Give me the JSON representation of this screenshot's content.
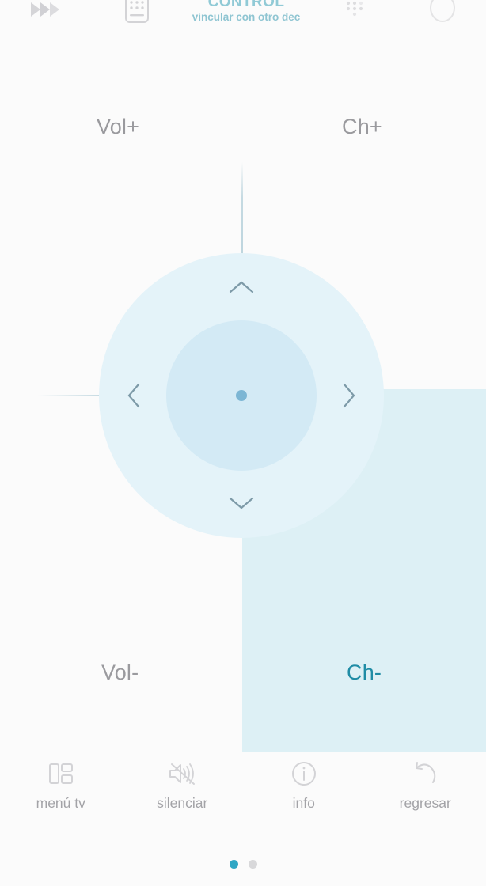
{
  "header": {
    "title": "CONTROL",
    "subtitle": "vincular con otro dec",
    "icons": {
      "forward": "fast-forward-icon",
      "keypad": "remote-keypad-icon",
      "numgrid": "number-grid-icon",
      "power": "power-icon"
    }
  },
  "colors": {
    "background": "#fbfbfb",
    "accent": "#2fa6c4",
    "active_text": "#1f8ca5",
    "press_highlight": "#ddf0f5",
    "dpad_outer": "#e4f3f9",
    "dpad_inner": "#d3eaf5",
    "dpad_center": "#7cb6d4",
    "label_gray": "#9a9a9e",
    "title_teal": "#3ba3b8",
    "subtitle_teal": "#8fc5d2"
  },
  "quadrants": {
    "vol_up": "Vol+",
    "ch_up": "Ch+",
    "vol_down": "Vol-",
    "ch_down": "Ch-",
    "active": "Ch-"
  },
  "dpad": {
    "up": "dpad-up",
    "down": "dpad-down",
    "left": "dpad-left",
    "right": "dpad-right",
    "ok": "dpad-ok"
  },
  "toolbar": [
    {
      "label": "menú tv",
      "icon": "tv-menu-icon"
    },
    {
      "label": "silenciar",
      "icon": "mute-icon"
    },
    {
      "label": "info",
      "icon": "info-icon"
    },
    {
      "label": "regresar",
      "icon": "back-icon"
    }
  ],
  "pager": {
    "total": 2,
    "current": 1
  }
}
